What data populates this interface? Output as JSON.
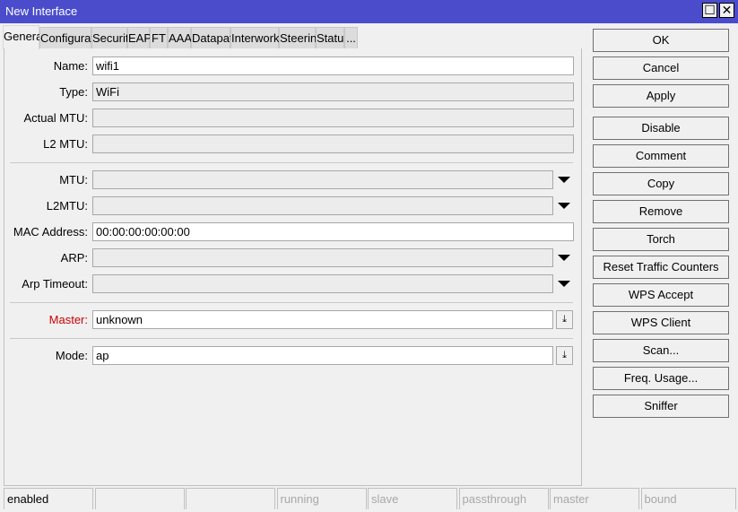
{
  "window": {
    "title": "New Interface",
    "maximize": "☐",
    "close": "✕"
  },
  "tabs": [
    "General",
    "Configuration",
    "Security",
    "EAP",
    "FT",
    "AAA",
    "Datapath",
    "Interworking",
    "Steering",
    "Status",
    "..."
  ],
  "fields": {
    "name": {
      "label": "Name:",
      "value": "wifi1"
    },
    "type": {
      "label": "Type:",
      "value": "WiFi"
    },
    "actual_mtu": {
      "label": "Actual MTU:",
      "value": ""
    },
    "l2_mtu": {
      "label": "L2 MTU:",
      "value": ""
    },
    "mtu": {
      "label": "MTU:",
      "value": ""
    },
    "l2mtu": {
      "label": "L2MTU:",
      "value": ""
    },
    "mac": {
      "label": "MAC Address:",
      "value": "00:00:00:00:00:00"
    },
    "arp": {
      "label": "ARP:",
      "value": ""
    },
    "arp_timeout": {
      "label": "Arp Timeout:",
      "value": ""
    },
    "master": {
      "label": "Master:",
      "value": "unknown",
      "label_color": "#cc0000"
    },
    "mode": {
      "label": "Mode:",
      "value": "ap"
    }
  },
  "buttons": [
    "OK",
    "Cancel",
    "Apply",
    "Disable",
    "Comment",
    "Copy",
    "Remove",
    "Torch",
    "Reset Traffic Counters",
    "WPS Accept",
    "WPS Client",
    "Scan...",
    "Freq. Usage...",
    "Sniffer"
  ],
  "status": [
    "enabled",
    "",
    "",
    "running",
    "slave",
    "passthrough",
    "master",
    "bound"
  ]
}
